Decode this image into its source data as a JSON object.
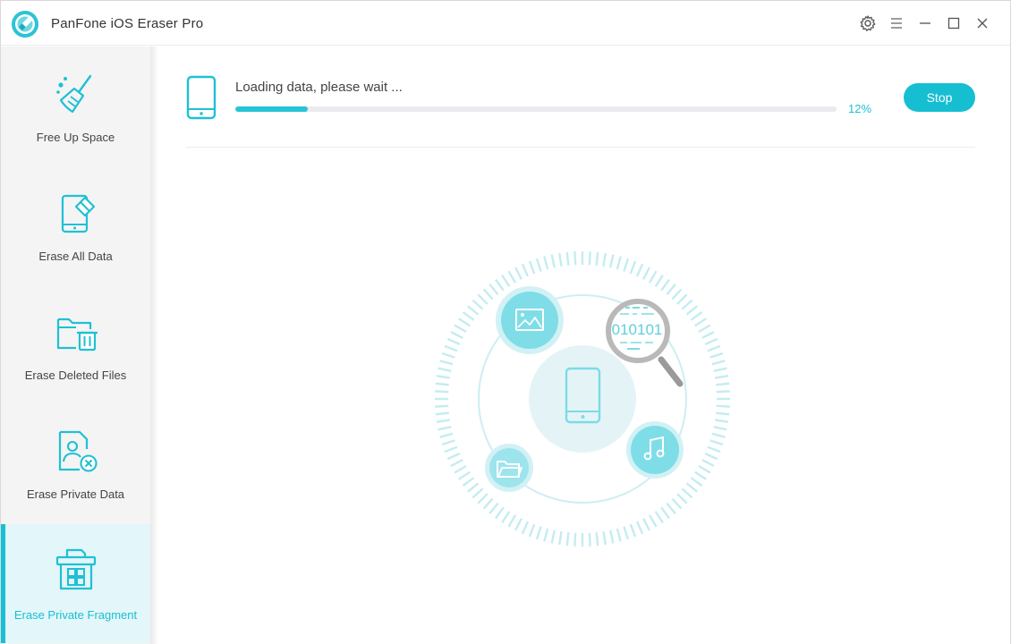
{
  "app": {
    "title": "PanFone iOS Eraser Pro"
  },
  "window_controls": [
    "settings-icon",
    "menu-icon",
    "minimize-icon",
    "maximize-icon",
    "close-icon"
  ],
  "sidebar": {
    "items": [
      {
        "label": "Free Up Space",
        "icon": "broom-icon",
        "active": false
      },
      {
        "label": "Erase All Data",
        "icon": "phone-eraser-icon",
        "active": false
      },
      {
        "label": "Erase Deleted Files",
        "icon": "folder-trash-icon",
        "active": false
      },
      {
        "label": "Erase Private Data",
        "icon": "private-file-icon",
        "active": false
      },
      {
        "label": "Erase Private Fragment",
        "icon": "fragment-box-icon",
        "active": true
      }
    ]
  },
  "main": {
    "loading_text": "Loading data, please wait ...",
    "progress": 12,
    "progress_label": "12%",
    "stop_label": "Stop",
    "scan_binary": "010101"
  },
  "colors": {
    "accent": "#16bed2",
    "active_bg": "#e3f6f9",
    "sidebar_bg": "#f4f4f4",
    "track": "#ebebef"
  }
}
